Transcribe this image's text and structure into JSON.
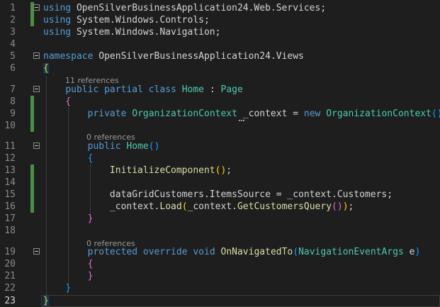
{
  "editor": {
    "line_numbers": [
      "1",
      "2",
      "3",
      "4",
      "5",
      "6",
      "7",
      "8",
      "9",
      "10",
      "11",
      "12",
      "13",
      "14",
      "15",
      "16",
      "17",
      "18",
      "19",
      "20",
      "21",
      "22",
      "23"
    ],
    "code_lens": {
      "class_refs": "11 references",
      "ctor_refs": "0 references",
      "method_refs": "0 references"
    },
    "tokens": {
      "l1": [
        "using",
        " OpenSilverBusinessApplication24.Web.Services;"
      ],
      "l2": [
        "using",
        " System.Windows.Controls;"
      ],
      "l3": [
        "using",
        " System.Windows.Navigation;"
      ],
      "l5": [
        "namespace",
        " OpenSilverBusinessApplication24.Views"
      ],
      "l6": [
        "{"
      ],
      "l7": [
        "public",
        " ",
        "partial",
        " ",
        "class",
        " ",
        "Home",
        " : ",
        "Page"
      ],
      "l8": [
        "{"
      ],
      "l9": [
        "private",
        " ",
        "OrganizationContext",
        " ",
        "_context",
        " = ",
        "new",
        " ",
        "OrganizationContext",
        "(",
        ")",
        ";"
      ],
      "l11": [
        "public",
        " ",
        "Home",
        "(",
        ")"
      ],
      "l12": [
        "{"
      ],
      "l13": [
        "InitializeComponent",
        "(",
        ")",
        ";"
      ],
      "l15": [
        "dataGridCustomers.ItemsSource = _context.Customers;"
      ],
      "l16": [
        "_context.",
        "Load",
        "(",
        "_context.",
        "GetCustomersQuery",
        "(",
        ")",
        ")",
        ";"
      ],
      "l17": [
        "}"
      ],
      "l19": [
        "protected",
        " ",
        "override",
        " ",
        "void",
        " ",
        "OnNavigatedTo",
        "(",
        "NavigationEventArgs",
        " e",
        ")"
      ],
      "l20": [
        "{"
      ],
      "l21": [
        "}"
      ],
      "l22": [
        "}"
      ],
      "l23": [
        "}"
      ]
    },
    "colors": {
      "background": "#1e1e1e",
      "keyword": "#569cd6",
      "type": "#4ec9b0",
      "method": "#dcdcaa",
      "text": "#d4d4d4",
      "line_number": "#8a8a8a",
      "modified_marker": "#4a8f45",
      "bracket_level1": "#ffd700",
      "bracket_level2": "#da70d6",
      "bracket_level3": "#179fff"
    },
    "current_line": "23"
  }
}
